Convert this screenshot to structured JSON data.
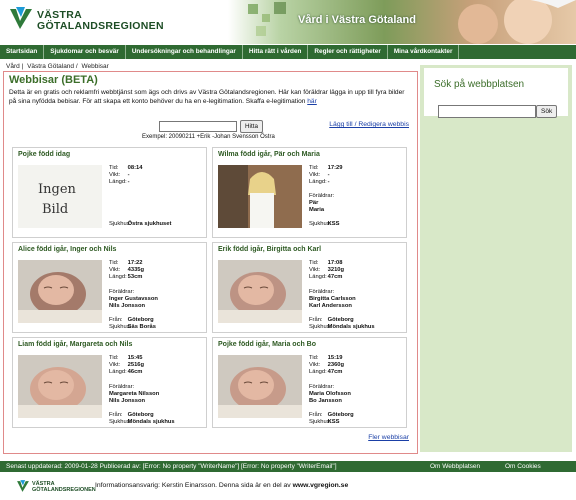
{
  "header": {
    "logo_line1": "VÄSTRA",
    "logo_line2": "GÖTALANDSREGIONEN",
    "hero_text": "Vård i Västra Götaland",
    "colors": {
      "brand_green": "#2f6a32",
      "title_green": "#3c6e2a",
      "sidebar_bg": "#d8e8c8",
      "border_red": "#e08a8a"
    }
  },
  "nav": [
    "Startsidan",
    "Sjukdomar och besvär",
    "Undersökningar och behandlingar",
    "Hitta rätt i vården",
    "Regler och rättigheter",
    "Mina vårdkontakter"
  ],
  "breadcrumb": [
    "Vård",
    "|",
    "Västra Götaland",
    "/",
    "Webbisar"
  ],
  "main": {
    "title": "Webbisar (BETA)",
    "intro": "Detta är en gratis och reklamfri webbtjänst som ägs och drivs av Västra Götalandsregionen. Här kan föräldrar lägga in upp till fyra bilder på sina nyfödda bebisar. För att skapa ett konto behöver du ha en e-legitimation. Skaffa e-legitimation ",
    "intro_link": "här",
    "search_placeholder": "",
    "search_button": "Hitta",
    "add_link": "Lägg till / Redigera webbis",
    "example": "Exempel: 20090211 +Erik -Johan Svensson Östra",
    "more_link": "Fler webbisar"
  },
  "labels": {
    "time": "Tid:",
    "weight": "Vikt:",
    "length": "Längd:",
    "parents": "Föräldrar:",
    "from": "Från:",
    "hospital": "Sjukhus:"
  },
  "babies": [
    {
      "title": "Pojke född idag",
      "time": "08:14",
      "weight": "-",
      "length": "-",
      "parents": [],
      "from": "",
      "hospital": "Östra sjukhuset",
      "photo": "ingen-bild",
      "photo_text1": "Ingen",
      "photo_text2": "Bild"
    },
    {
      "title": "Wilma född igår, Pär och Maria",
      "time": "17:29",
      "weight": "-",
      "length": "-",
      "parents": [
        "Pär",
        "Maria"
      ],
      "from": "",
      "hospital": "KSS",
      "photo": "girl"
    },
    {
      "title": "Alice född igår, Inger och Nils",
      "time": "17:22",
      "weight": "4335g",
      "length": "53cm",
      "parents": [
        "Inger Gustavsson",
        "Nils Jonsson"
      ],
      "from": "Göteborg",
      "hospital": "Säs Borås",
      "photo": "baby"
    },
    {
      "title": "Erik född igår, Birgitta och Karl",
      "time": "17:08",
      "weight": "3210g",
      "length": "47cm",
      "parents": [
        "Birgitta Carlsson",
        "Karl Andersson"
      ],
      "from": "Göteborg",
      "hospital": "Möndals sjukhus",
      "photo": "baby"
    },
    {
      "title": "Liam född igår, Margareta och Nils",
      "time": "15:45",
      "weight": "2516g",
      "length": "46cm",
      "parents": [
        "Margareta Nilsson",
        "Nils Jonsson"
      ],
      "from": "Göteborg",
      "hospital": "Möndals sjukhus",
      "photo": "baby"
    },
    {
      "title": "Pojke född igår, Maria och Bo",
      "time": "15:19",
      "weight": "2360g",
      "length": "47cm",
      "parents": [
        "Maria Olofsson",
        "Bo Jansson"
      ],
      "from": "Göteborg",
      "hospital": "KSS",
      "photo": "baby"
    }
  ],
  "sidebar": {
    "title": "Sök på webbplatsen",
    "button": "Sök"
  },
  "footer": {
    "updated": "Senast uppdaterad: 2009-01-28 Publicerad av: [Error: No property \"WriterName\"]   [Error: No property \"WriterEmail\"]",
    "about": "Om Webbplatsen",
    "cookies": "Om Cookies",
    "logo_line1": "VÄSTRA",
    "logo_line2": "GÖTALANDSREGIONEN",
    "info_prefix": "Informationsansvarig: Kerstin Einarsson. Denna sida är en del av ",
    "site": "www.vgregion.se"
  }
}
